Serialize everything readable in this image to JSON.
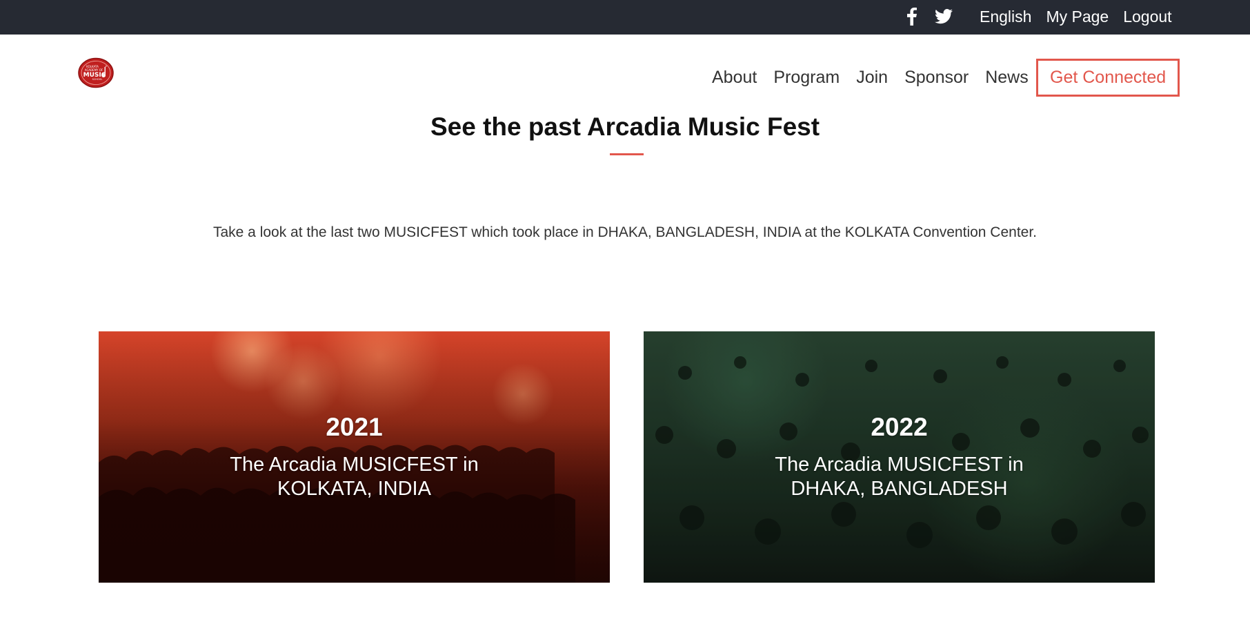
{
  "topbar": {
    "social": [
      {
        "icon": "facebook-icon"
      },
      {
        "icon": "twitter-icon"
      }
    ],
    "links": [
      {
        "label": "English"
      },
      {
        "label": "My Page"
      },
      {
        "label": "Logout"
      }
    ]
  },
  "header": {
    "logo_text": {
      "line1": "KOLKATA",
      "line2": "ACADEMY OF",
      "line3": "MUSIC",
      "line4": "SCHOOL"
    },
    "nav": [
      {
        "label": "About"
      },
      {
        "label": "Program"
      },
      {
        "label": "Join"
      },
      {
        "label": "Sponsor"
      },
      {
        "label": "News"
      }
    ],
    "cta_label": "Get Connected"
  },
  "main": {
    "title": "See the past Arcadia Music Fest",
    "description": "Take a look at the last two MUSICFEST which took place in DHAKA, BANGLADESH, INDIA at the KOLKATA Convention Center.",
    "cards": [
      {
        "year": "2021",
        "caption_line1": "The Arcadia MUSICFEST in",
        "caption_line2": "KOLKATA, INDIA"
      },
      {
        "year": "2022",
        "caption_line1": "The Arcadia MUSICFEST in",
        "caption_line2": "DHAKA, BANGLADESH"
      }
    ]
  },
  "colors": {
    "topbar_bg": "#262a33",
    "accent": "#e2574c",
    "text": "#333333"
  }
}
